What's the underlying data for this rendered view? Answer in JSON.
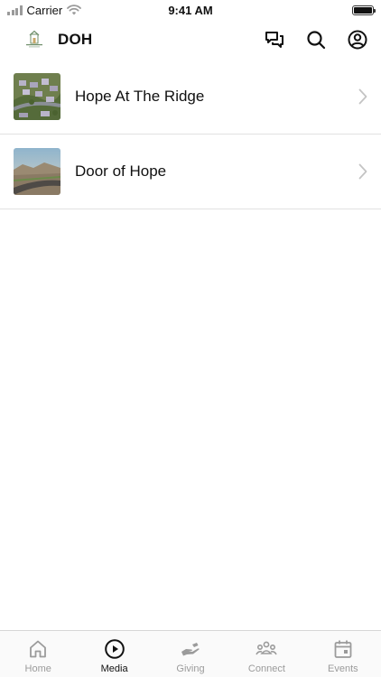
{
  "status_bar": {
    "carrier": "Carrier",
    "time": "9:41 AM",
    "battery_level": 1.0
  },
  "header": {
    "title": "DOH",
    "logo_icon": "church-logo",
    "actions": [
      {
        "icon": "chat-bubbles-icon"
      },
      {
        "icon": "search-icon"
      },
      {
        "icon": "account-icon"
      }
    ]
  },
  "media_list": {
    "items": [
      {
        "label": "Hope At The Ridge",
        "thumbnail": "aerial-neighborhood-image"
      },
      {
        "label": "Door of Hope",
        "thumbnail": "desert-road-image"
      }
    ]
  },
  "tab_bar": {
    "active": "Media",
    "tabs": [
      {
        "label": "Home",
        "icon": "home-icon"
      },
      {
        "label": "Media",
        "icon": "play-circle-icon"
      },
      {
        "label": "Giving",
        "icon": "giving-hand-icon"
      },
      {
        "label": "Connect",
        "icon": "people-icon"
      },
      {
        "label": "Events",
        "icon": "calendar-icon"
      }
    ]
  },
  "colors": {
    "active": "#111111",
    "inactive": "#9b9b9b",
    "divider": "#e1e1e1",
    "background": "#ffffff"
  }
}
